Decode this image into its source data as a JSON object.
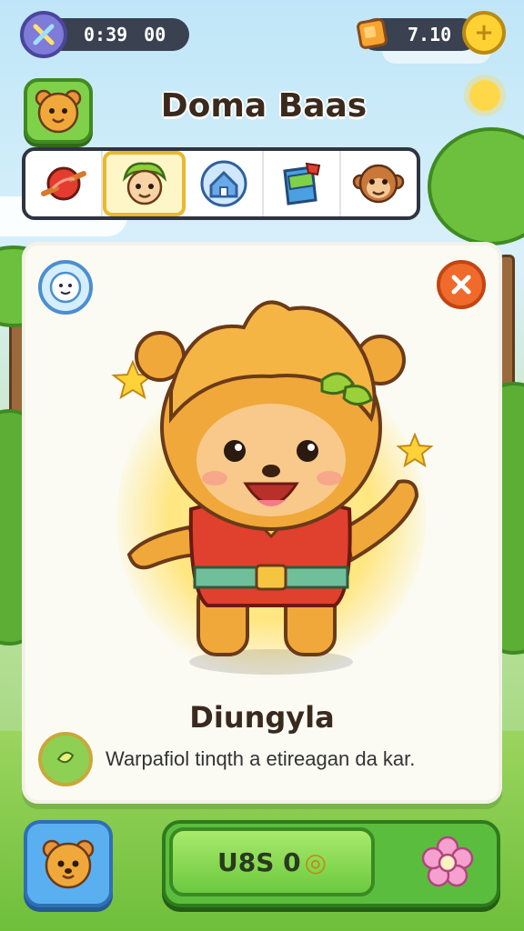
{
  "status": {
    "timer": "0:39",
    "timer_count": "00",
    "currency": "7.10"
  },
  "title": "Doma Baas",
  "tabs": [
    {
      "name": "candy",
      "active": false
    },
    {
      "name": "character",
      "active": true
    },
    {
      "name": "home",
      "active": false
    },
    {
      "name": "flag",
      "active": false
    },
    {
      "name": "pet",
      "active": false
    }
  ],
  "character": {
    "name": "Diungyla",
    "description": "Warpafiol tinqth a etireagan da kar."
  },
  "buy": {
    "label": "U8S 0",
    "coin": "◎"
  },
  "colors": {
    "accent_green": "#6cc93f",
    "close_orange": "#f06a2b",
    "tab_highlight": "#e7b92e",
    "bear_orange": "#f0a83a"
  }
}
